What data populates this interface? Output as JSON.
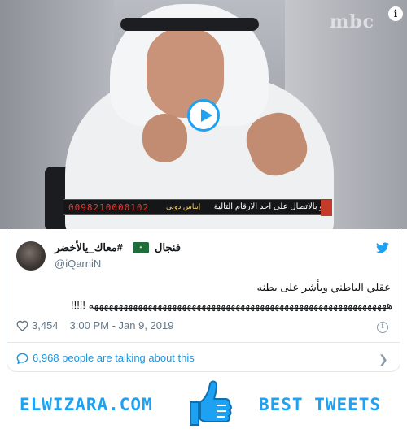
{
  "video": {
    "channel_logo": "mbc",
    "info_label": "i",
    "ticker_text": "او بالاتصال على احد الارقام التالية",
    "ticker_name": "إيناس دوني",
    "ticker_phone": "0098210000102"
  },
  "tweet": {
    "display_name_rtl": "#معاك_يالأخضر",
    "display_name_ltr": "فنجال",
    "handle": "@iQarniN",
    "text_line1": "عقلي الباطني ويأشر على بطنه",
    "text_line2": "هههههههههههههههههههههههههههههههههههههههههههههههههههههههههههههه !!!!!",
    "likes": "3,454",
    "timestamp": "3:00 PM - Jan 9, 2019",
    "talking": "6,968 people are talking about this"
  },
  "footer": {
    "left": "ELWIZARA.COM",
    "right": "BEST TWEETS"
  },
  "colors": {
    "accent": "#1da1f2",
    "link": "#1b95e0",
    "muted": "#657786"
  }
}
